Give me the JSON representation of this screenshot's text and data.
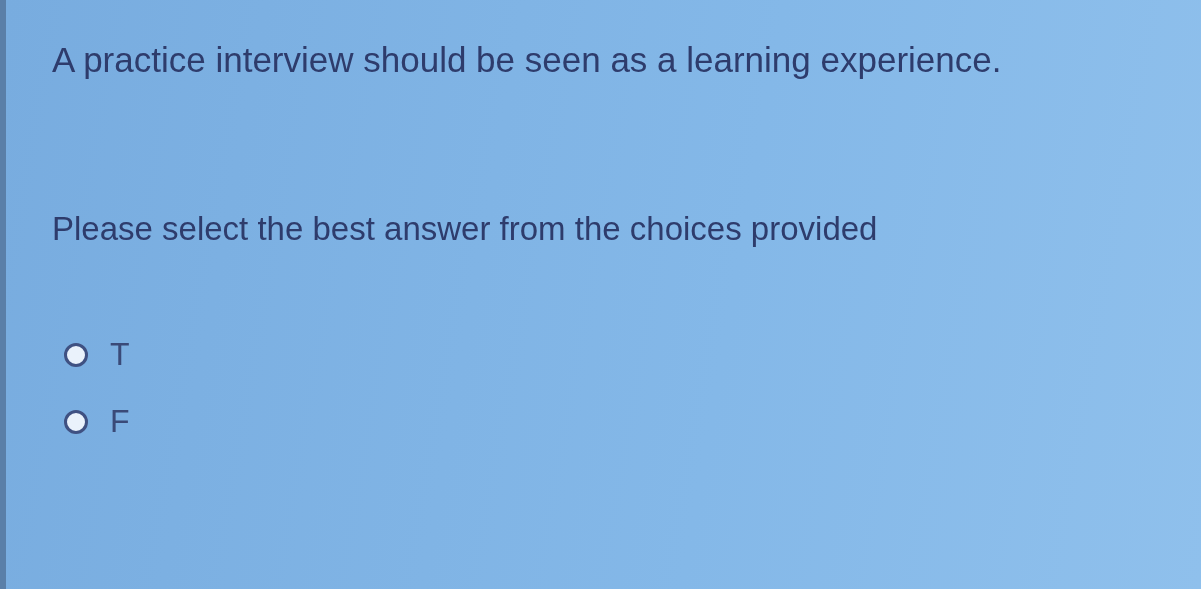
{
  "question": "A practice interview should be seen as a learning experience.",
  "instruction": "Please select the best answer from the choices provided",
  "choices": [
    {
      "label": "T",
      "selected": false
    },
    {
      "label": "F",
      "selected": false
    }
  ]
}
